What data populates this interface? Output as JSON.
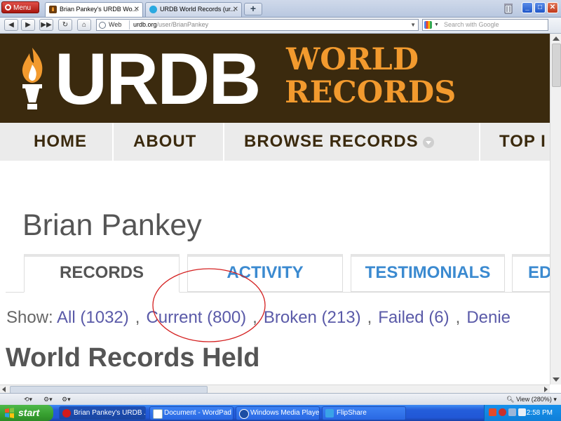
{
  "browser": {
    "menu_label": "Menu",
    "tabs": [
      {
        "title": "Brian Pankey's URDB Wo...",
        "active": true
      },
      {
        "title": "URDB World Records (ur...",
        "active": false
      }
    ],
    "web_label": "Web",
    "url_host": "urdb.org",
    "url_path": "/user/BrianPankey",
    "search_placeholder": "Search with Google"
  },
  "site": {
    "logo_main": "URDB",
    "logo_line1": "WORLD",
    "logo_line2": "RECORDS",
    "nav": [
      "HOME",
      "ABOUT",
      "BROWSE RECORDS",
      "TOP I"
    ],
    "brand_colors": {
      "banner": "#3b2a0e",
      "accent": "#f29a2e",
      "link": "#3b8ad0"
    }
  },
  "profile": {
    "name": "Brian Pankey",
    "tabs": [
      "RECORDS",
      "ACTIVITY",
      "TESTIMONIALS",
      "ED"
    ],
    "show_label": "Show:",
    "filters": [
      {
        "label": "All (1032)"
      },
      {
        "label": "Current (800)"
      },
      {
        "label": "Broken (213)"
      },
      {
        "label": "Failed (6)"
      },
      {
        "label": "Denie"
      }
    ],
    "section_title": "World Records Held"
  },
  "status": {
    "zoom": "View (280%)"
  },
  "taskbar": {
    "start": "start",
    "tasks": [
      {
        "label": "Brian Pankey's URDB ..."
      },
      {
        "label": "Document - WordPad"
      },
      {
        "label": "Windows Media Player"
      },
      {
        "label": "FlipShare"
      }
    ],
    "clock": "2:58 PM"
  }
}
